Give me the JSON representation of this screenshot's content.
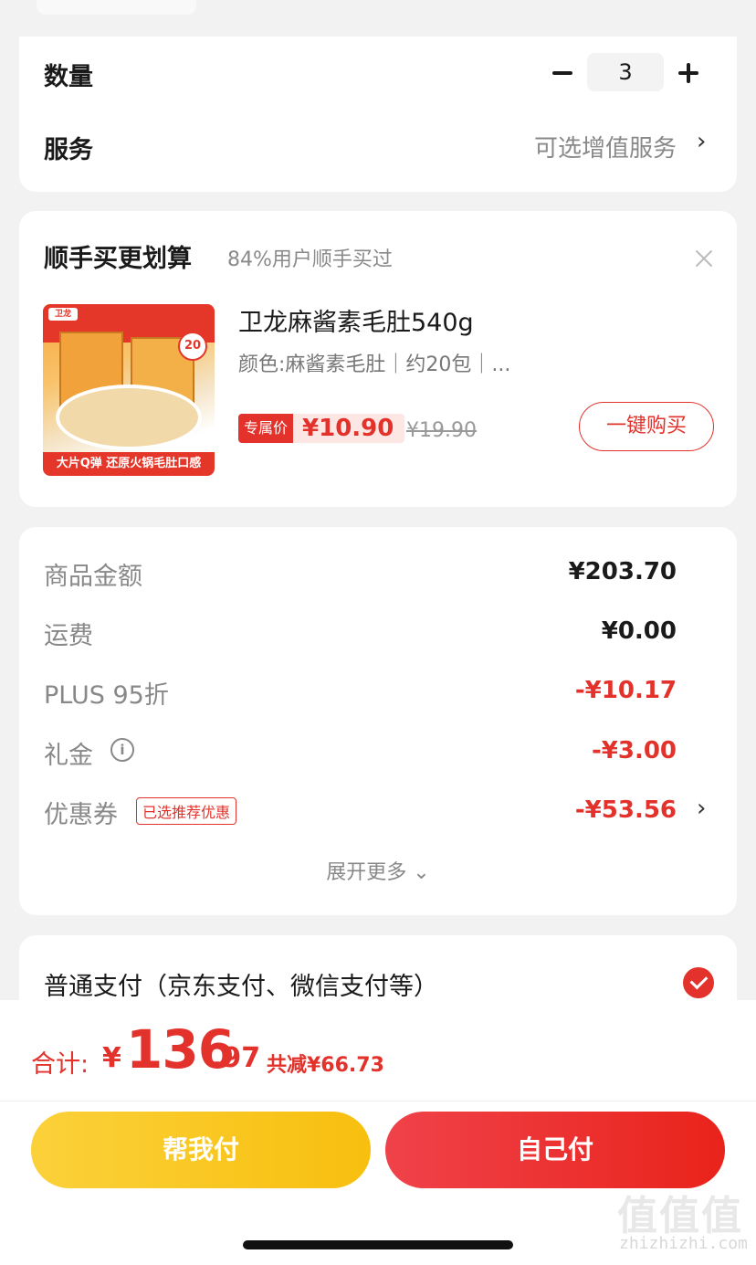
{
  "quantity_row": {
    "label": "数量",
    "value": "3"
  },
  "service_row": {
    "label": "服务",
    "value": "可选增值服务",
    "chevron": "›"
  },
  "upsell": {
    "title": "顺手买更划算",
    "subtitle": "84%用户顺手买过",
    "product": {
      "name": "卫龙麻酱素毛肚540g",
      "spec": "颜色:麻酱素毛肚｜约20包｜...",
      "price_label": "专属价",
      "price": "¥10.90",
      "original_price": "¥19.90",
      "buy_button": "一键购买",
      "image_logo": "卫龙",
      "image_badge": "20",
      "image_caption": "大片Q弹 还原火锅毛肚口感"
    }
  },
  "fees": {
    "goods_label": "商品金额",
    "goods_value": "¥203.70",
    "shipping_label": "运费",
    "shipping_value": "¥0.00",
    "plus_label": "PLUS 95折",
    "plus_value": "-¥10.17",
    "gift_label": "礼金",
    "gift_value": "-¥3.00",
    "coupon_label": "优惠券",
    "coupon_tag": "已选推荐优惠",
    "coupon_value": "-¥53.56",
    "expand_label": "展开更多 ⌄"
  },
  "payment": {
    "method": "普通支付（京东支付、微信支付等）"
  },
  "summary": {
    "label": "合计:",
    "currency": "¥",
    "integer": "136",
    "decimal": ".97",
    "saved": "共减¥66.73"
  },
  "buttons": {
    "help_pay": "帮我付",
    "self_pay": "自己付"
  },
  "watermark": {
    "logo": "值值值",
    "url": "zhizhizhi.com"
  },
  "colors": {
    "accent_red": "#e3322b",
    "yellow": "#f8bf0e"
  }
}
